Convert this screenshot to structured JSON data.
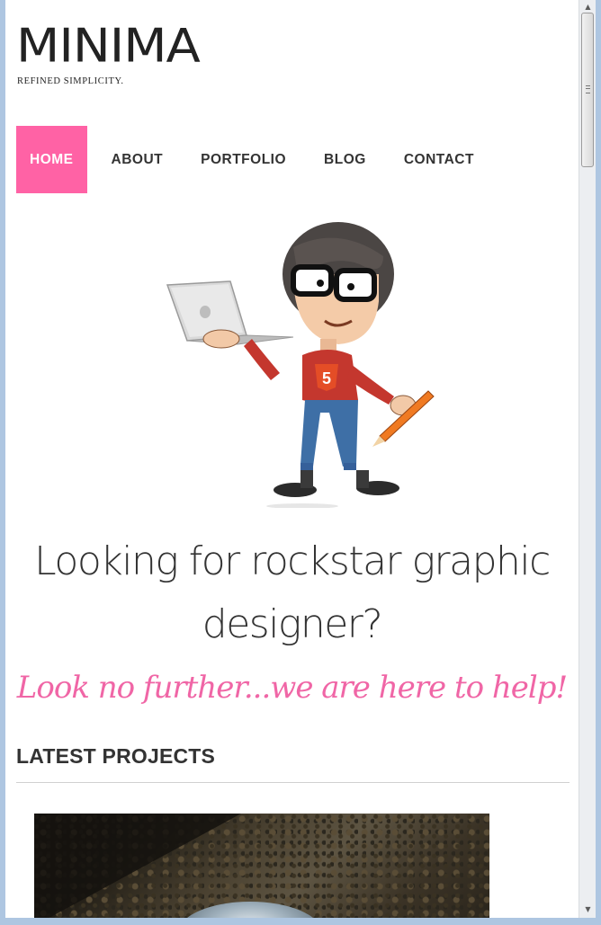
{
  "site": {
    "logo": "MINIMA",
    "tagline": "REFINED SIMPLICITY."
  },
  "nav": {
    "items": [
      {
        "label": "HOME",
        "active": true
      },
      {
        "label": "ABOUT",
        "active": false
      },
      {
        "label": "PORTFOLIO",
        "active": false
      },
      {
        "label": "BLOG",
        "active": false
      },
      {
        "label": "CONTACT",
        "active": false
      }
    ]
  },
  "hero": {
    "illustration_icon": "designer-character-icon",
    "headline_line1": "Looking for rockstar graphic",
    "headline_line2": "designer?",
    "subheadline": "Look no further...we are here to help!"
  },
  "latest_projects": {
    "title": "LATEST PROJECTS"
  },
  "colors": {
    "accent": "#ff62a5",
    "script": "#f066a6",
    "text": "#333333"
  }
}
